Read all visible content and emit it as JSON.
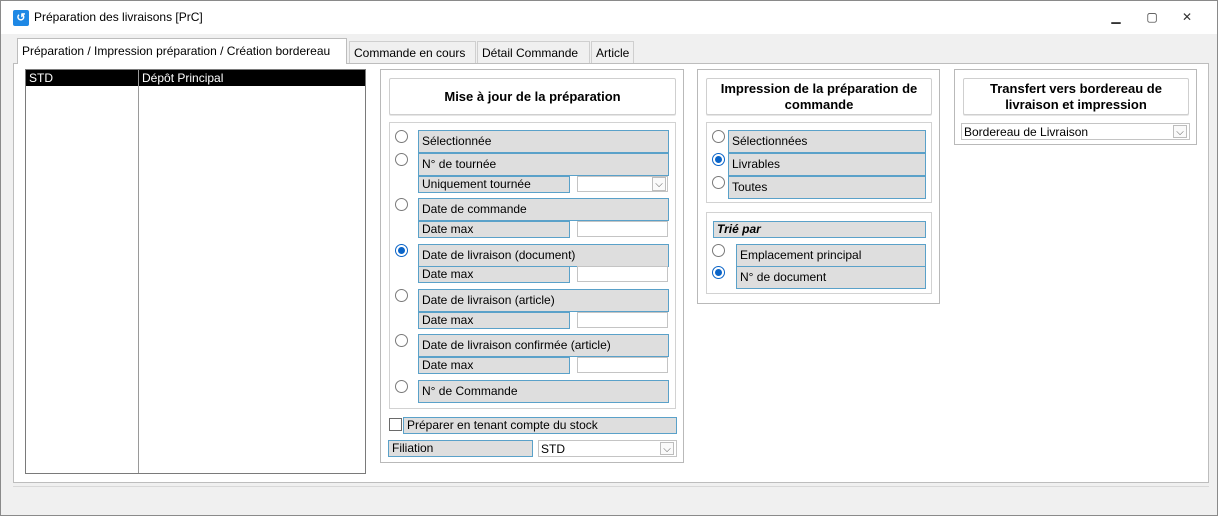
{
  "window": {
    "title": "Préparation des livraisons [PrC]",
    "icon": "app-icon",
    "icon_color": "#1e88e5",
    "minimize": "▁",
    "maximize": "▢",
    "close": "✕"
  },
  "tabs": [
    {
      "label": "Préparation / Impression préparation / Création bordereau",
      "active": true
    },
    {
      "label": "Commande en cours",
      "active": false
    },
    {
      "label": "Détail Commande",
      "active": false
    },
    {
      "label": "Article",
      "active": false
    }
  ],
  "depot_grid": {
    "rows": [
      {
        "code": "STD",
        "name": "Dépôt Principal",
        "selected": true
      }
    ]
  },
  "mise_a_jour": {
    "title": "Mise à jour de la préparation",
    "options": {
      "selectionnee": "Sélectionnée",
      "no_tournee": "N° de tournée",
      "uniquement_tournee": "Uniquement tournée",
      "date_commande": "Date de commande",
      "date_max_1": "Date max",
      "date_livraison_doc": "Date de livraison (document)",
      "date_max_2": "Date max",
      "date_livraison_art": "Date de livraison (article)",
      "date_max_3": "Date max",
      "date_livraison_conf": "Date de livraison confirmée (article)",
      "date_max_4": "Date max",
      "no_commande": "N° de Commande"
    },
    "selected_option": "date_livraison_doc",
    "stock_checkbox_label": "Préparer en tenant compte du stock",
    "stock_checked": false,
    "filiation_label": "Filiation",
    "filiation_value": "STD"
  },
  "impression": {
    "title_line1": "Impression de la préparation de",
    "title_line2": "commande",
    "options": {
      "selectionnees": "Sélectionnées",
      "livrables": "Livrables",
      "toutes": "Toutes"
    },
    "selected_option": "livrables",
    "trie_par_label": "Trié par",
    "sort_options": {
      "emplacement": "Emplacement principal",
      "no_document": "N° de document"
    },
    "selected_sort": "no_document"
  },
  "transfert": {
    "title_line1": "Transfert vers bordereau de",
    "title_line2": "livraison et impression",
    "dropdown_value": "Bordereau de Livraison"
  },
  "colors": {
    "accent": "#0a64c8",
    "field_border": "#5aa1c9",
    "label_bg": "#dedede"
  }
}
